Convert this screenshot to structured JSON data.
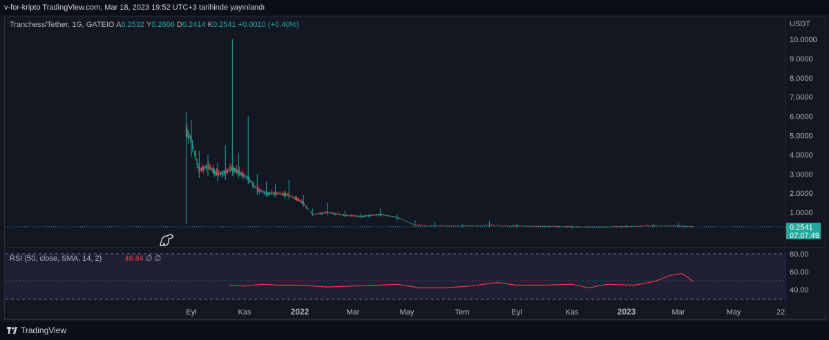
{
  "header": {
    "text": "v-for-kripto TradingView.com, Mar 18, 2023 19:52 UTC+3 tarihinde yayınlandı"
  },
  "legend": {
    "symbol": "Tranchess/Tether, 1G, GATEIO",
    "open_label": "A",
    "open": "0.2532",
    "high_label": "Y",
    "high": "0.2606",
    "low_label": "D",
    "low": "0.2414",
    "close_label": "K",
    "close": "0.2541",
    "change": "+0.0010 (+0.40%)"
  },
  "rsi_legend": {
    "label": "RSI (50, close, SMA, 14, 2)",
    "value": "48.84",
    "extra1": "∅",
    "extra2": "∅"
  },
  "price_tag": {
    "price": "0.2541",
    "countdown": "07:07:49"
  },
  "brand": {
    "name": "TradingView"
  },
  "colors": {
    "background": "#131722",
    "up": "#26a69a",
    "down": "#ef5350",
    "rsi_line": "#f23645",
    "rsi_band": "#7e57c2"
  },
  "chart_data": [
    {
      "type": "candlestick",
      "title": "Tranchess/Tether, 1G, GATEIO",
      "y_unit": "USDT",
      "ylim": [
        0,
        10.5
      ],
      "y_ticks": [
        "1.0000",
        "2.0000",
        "3.0000",
        "4.0000",
        "5.0000",
        "6.0000",
        "7.0000",
        "8.0000",
        "9.0000",
        "10.0000"
      ],
      "x_ticks": [
        "Eyl",
        "Kas",
        "2022",
        "Mar",
        "May",
        "Tem",
        "Eyl",
        "Kas",
        "2023",
        "Mar",
        "May",
        "22"
      ],
      "last_price": 0.2541,
      "series": [
        {
          "date": "2021-08-26",
          "close": 5.2,
          "high": 6.2,
          "low": 0.4
        },
        {
          "date": "2021-09-01",
          "close": 4.8,
          "high": 5.8,
          "low": 3.9
        },
        {
          "date": "2021-09-10",
          "close": 3.2,
          "high": 4.2,
          "low": 2.8
        },
        {
          "date": "2021-09-20",
          "close": 3.4,
          "high": 4.0,
          "low": 2.9
        },
        {
          "date": "2021-10-01",
          "close": 3.0,
          "high": 3.6,
          "low": 2.6
        },
        {
          "date": "2021-10-10",
          "close": 3.1,
          "high": 4.5,
          "low": 2.7
        },
        {
          "date": "2021-10-18",
          "close": 3.3,
          "high": 10.0,
          "low": 2.9
        },
        {
          "date": "2021-10-25",
          "close": 3.1,
          "high": 4.1,
          "low": 2.8
        },
        {
          "date": "2021-11-05",
          "close": 2.8,
          "high": 6.0,
          "low": 2.5
        },
        {
          "date": "2021-11-15",
          "close": 2.2,
          "high": 3.0,
          "low": 1.9
        },
        {
          "date": "2021-11-25",
          "close": 2.0,
          "high": 2.6,
          "low": 1.8
        },
        {
          "date": "2021-12-05",
          "close": 2.0,
          "high": 2.5,
          "low": 1.8
        },
        {
          "date": "2021-12-20",
          "close": 1.9,
          "high": 2.7,
          "low": 1.7
        },
        {
          "date": "2022-01-05",
          "close": 1.5,
          "high": 1.9,
          "low": 1.3
        },
        {
          "date": "2022-01-15",
          "close": 0.9,
          "high": 1.2,
          "low": 0.8
        },
        {
          "date": "2022-02-01",
          "close": 1.0,
          "high": 1.5,
          "low": 0.85
        },
        {
          "date": "2022-02-20",
          "close": 0.85,
          "high": 1.1,
          "low": 0.75
        },
        {
          "date": "2022-03-10",
          "close": 0.8,
          "high": 0.95,
          "low": 0.7
        },
        {
          "date": "2022-04-01",
          "close": 0.9,
          "high": 1.2,
          "low": 0.8
        },
        {
          "date": "2022-04-20",
          "close": 0.75,
          "high": 0.9,
          "low": 0.6
        },
        {
          "date": "2022-05-10",
          "close": 0.35,
          "high": 0.6,
          "low": 0.25
        },
        {
          "date": "2022-06-01",
          "close": 0.3,
          "high": 0.5,
          "low": 0.2
        },
        {
          "date": "2022-07-01",
          "close": 0.3,
          "high": 0.4,
          "low": 0.2
        },
        {
          "date": "2022-08-01",
          "close": 0.35,
          "high": 0.55,
          "low": 0.25
        },
        {
          "date": "2022-09-01",
          "close": 0.3,
          "high": 0.4,
          "low": 0.22
        },
        {
          "date": "2022-10-01",
          "close": 0.28,
          "high": 0.35,
          "low": 0.2
        },
        {
          "date": "2022-11-01",
          "close": 0.25,
          "high": 0.32,
          "low": 0.18
        },
        {
          "date": "2022-12-01",
          "close": 0.24,
          "high": 0.3,
          "low": 0.2
        },
        {
          "date": "2023-01-01",
          "close": 0.27,
          "high": 0.32,
          "low": 0.22
        },
        {
          "date": "2023-02-01",
          "close": 0.32,
          "high": 0.4,
          "low": 0.25
        },
        {
          "date": "2023-03-01",
          "close": 0.3,
          "high": 0.45,
          "low": 0.24
        },
        {
          "date": "2023-03-18",
          "close": 0.2541,
          "high": 0.2606,
          "low": 0.2414
        }
      ]
    },
    {
      "type": "line",
      "title": "RSI (50, close, SMA, 14, 2)",
      "ylim": [
        30,
        85
      ],
      "y_ticks": [
        "40.00",
        "60.00",
        "80.00"
      ],
      "bands": [
        30,
        70
      ],
      "last_value": 48.84,
      "series": [
        {
          "date": "2021-10-15",
          "value": 45
        },
        {
          "date": "2021-11-01",
          "value": 44
        },
        {
          "date": "2021-11-20",
          "value": 46
        },
        {
          "date": "2021-12-10",
          "value": 45
        },
        {
          "date": "2022-01-01",
          "value": 45
        },
        {
          "date": "2022-02-01",
          "value": 43
        },
        {
          "date": "2022-03-01",
          "value": 44
        },
        {
          "date": "2022-04-01",
          "value": 45
        },
        {
          "date": "2022-04-20",
          "value": 46
        },
        {
          "date": "2022-05-15",
          "value": 42
        },
        {
          "date": "2022-06-10",
          "value": 42
        },
        {
          "date": "2022-07-10",
          "value": 44
        },
        {
          "date": "2022-08-10",
          "value": 48
        },
        {
          "date": "2022-09-01",
          "value": 45
        },
        {
          "date": "2022-10-01",
          "value": 45
        },
        {
          "date": "2022-11-01",
          "value": 46
        },
        {
          "date": "2022-11-20",
          "value": 42
        },
        {
          "date": "2022-12-10",
          "value": 46
        },
        {
          "date": "2023-01-10",
          "value": 45
        },
        {
          "date": "2023-02-01",
          "value": 49
        },
        {
          "date": "2023-02-20",
          "value": 56
        },
        {
          "date": "2023-03-05",
          "value": 58
        },
        {
          "date": "2023-03-18",
          "value": 48.84
        }
      ]
    }
  ]
}
